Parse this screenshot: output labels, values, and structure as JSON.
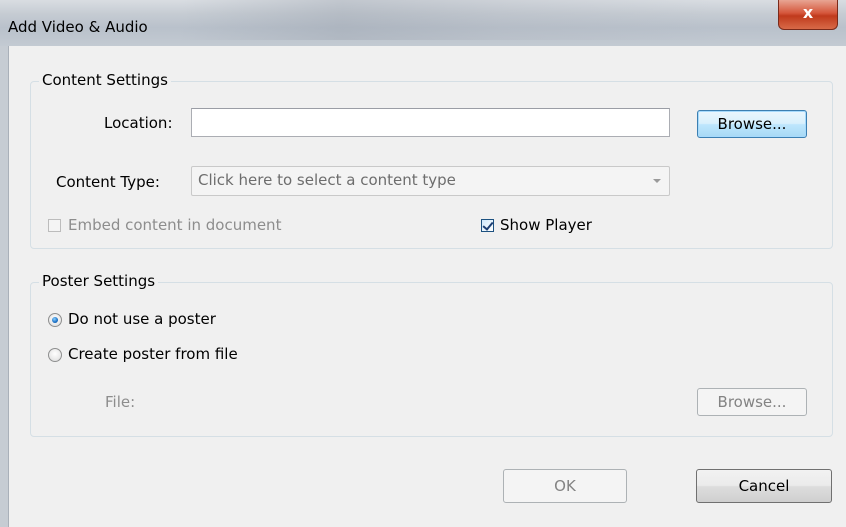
{
  "window": {
    "title": "Add Video & Audio",
    "close_glyph": "x"
  },
  "content_settings": {
    "legend": "Content Settings",
    "location_label": "Location:",
    "location_value": "",
    "browse_label": "Browse...",
    "content_type_label": "Content Type:",
    "content_type_value": "Click here to select a content type",
    "embed_label": "Embed content in document",
    "embed_checked": false,
    "embed_enabled": false,
    "show_player_label": "Show Player",
    "show_player_checked": true
  },
  "poster_settings": {
    "legend": "Poster Settings",
    "option_no_poster": "Do not use a poster",
    "option_from_file": "Create poster from file",
    "selected": "no_poster",
    "file_label": "File:",
    "browse_label": "Browse..."
  },
  "footer": {
    "ok_label": "OK",
    "cancel_label": "Cancel"
  }
}
